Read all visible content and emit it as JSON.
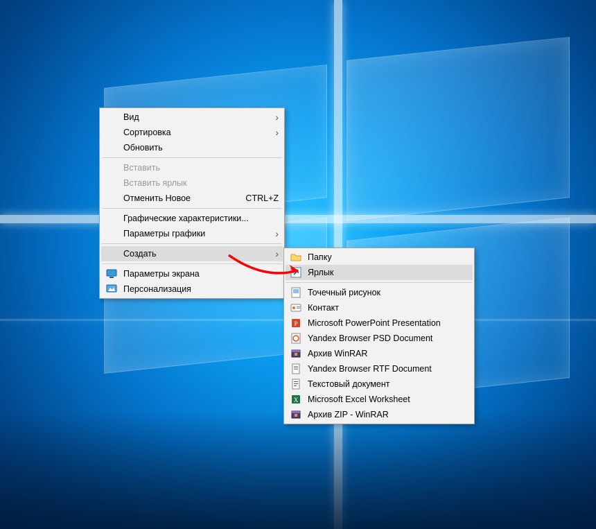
{
  "context_menu": {
    "items": [
      {
        "label": "Вид",
        "has_submenu": true
      },
      {
        "label": "Сортировка",
        "has_submenu": true
      },
      {
        "label": "Обновить",
        "has_submenu": false
      },
      {
        "separator": true
      },
      {
        "label": "Вставить",
        "disabled": true
      },
      {
        "label": "Вставить ярлык",
        "disabled": true
      },
      {
        "label": "Отменить Новое",
        "shortcut": "CTRL+Z"
      },
      {
        "separator": true
      },
      {
        "label": "Графические характеристики..."
      },
      {
        "label": "Параметры графики",
        "has_submenu": true
      },
      {
        "separator": true
      },
      {
        "label": "Создать",
        "has_submenu": true,
        "highlighted": true
      },
      {
        "separator": true
      },
      {
        "label": "Параметры экрана",
        "icon": "display-settings-icon"
      },
      {
        "label": "Персонализация",
        "icon": "personalization-icon"
      }
    ]
  },
  "submenu_new": {
    "items": [
      {
        "label": "Папку",
        "icon": "folder-icon"
      },
      {
        "label": "Ярлык",
        "icon": "shortcut-icon",
        "highlighted": true
      },
      {
        "separator": true
      },
      {
        "label": "Точечный рисунок",
        "icon": "bitmap-icon"
      },
      {
        "label": "Контакт",
        "icon": "contact-icon"
      },
      {
        "label": "Microsoft PowerPoint Presentation",
        "icon": "powerpoint-icon"
      },
      {
        "label": "Yandex Browser PSD Document",
        "icon": "psd-icon"
      },
      {
        "label": "Архив WinRAR",
        "icon": "winrar-icon"
      },
      {
        "label": "Yandex Browser RTF Document",
        "icon": "rtf-icon"
      },
      {
        "label": "Текстовый документ",
        "icon": "text-icon"
      },
      {
        "label": "Microsoft Excel Worksheet",
        "icon": "excel-icon"
      },
      {
        "label": "Архив ZIP - WinRAR",
        "icon": "winrar-icon"
      }
    ]
  },
  "annotation": {
    "arrow_color": "#ff0000"
  }
}
